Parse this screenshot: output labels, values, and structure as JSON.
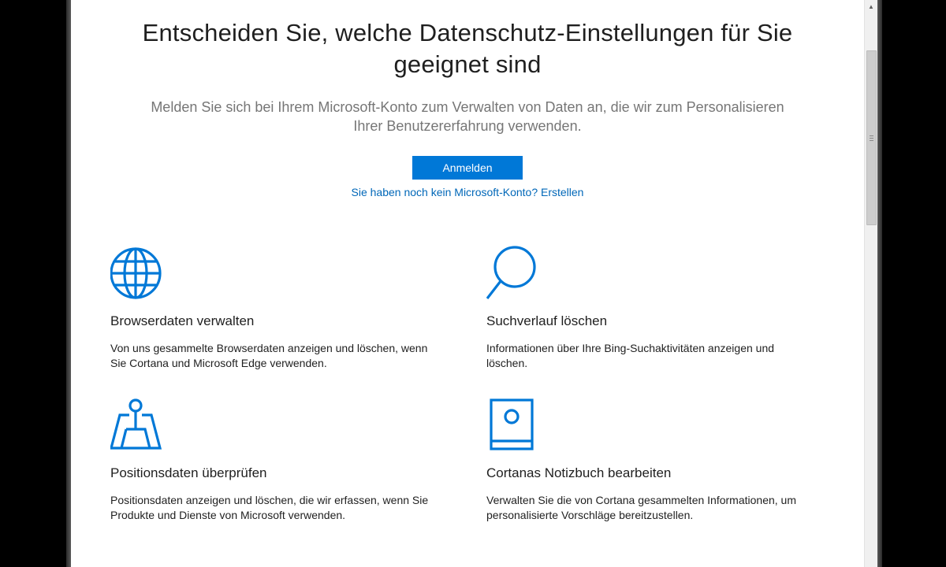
{
  "header": {
    "title_line1": "Entscheiden Sie, welche Datenschutz-Einstellungen für Sie",
    "title_line2": "geeignet sind",
    "subtitle_line1": "Melden Sie sich bei Ihrem Microsoft-Konto zum Verwalten von Daten an, die wir zum Personalisieren",
    "subtitle_line2": "Ihrer Benutzererfahrung verwenden."
  },
  "actions": {
    "signin_label": "Anmelden",
    "create_account_link": "Sie haben noch kein Microsoft-Konto? Erstellen"
  },
  "features": [
    {
      "icon": "globe-icon",
      "title": "Browserdaten verwalten",
      "desc_line1": "Von uns gesammelte Browserdaten anzeigen und löschen, wenn",
      "desc_line2": "Sie Cortana und Microsoft Edge verwenden."
    },
    {
      "icon": "search-icon",
      "title": "Suchverlauf löschen",
      "desc_line1": "Informationen über Ihre Bing-Suchaktivitäten anzeigen und",
      "desc_line2": "löschen."
    },
    {
      "icon": "location-pin-icon",
      "title": "Positionsdaten überprüfen",
      "desc_line1": "Positionsdaten anzeigen und löschen, die wir erfassen, wenn Sie",
      "desc_line2": "Produkte und Dienste von Microsoft verwenden."
    },
    {
      "icon": "notebook-icon",
      "title": "Cortanas Notizbuch bearbeiten",
      "desc_line1": "Verwalten Sie die von Cortana gesammelten Informationen, um",
      "desc_line2": "personalisierte Vorschläge bereitzustellen."
    }
  ],
  "colors": {
    "accent": "#0078d7",
    "link": "#0067b8",
    "icon": "#0078d7",
    "subtitle": "#767676"
  }
}
